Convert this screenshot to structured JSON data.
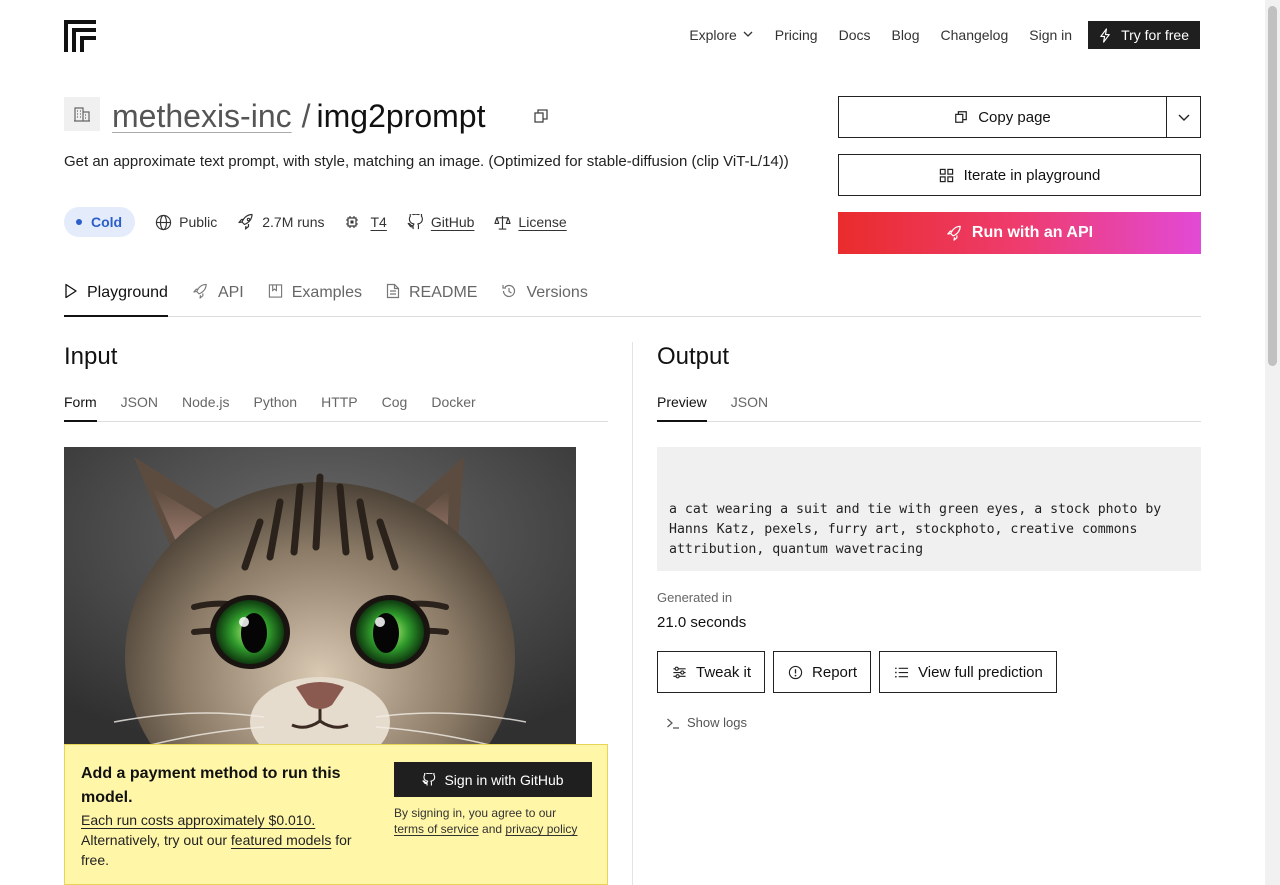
{
  "nav": {
    "explore": "Explore",
    "pricing": "Pricing",
    "docs": "Docs",
    "blog": "Blog",
    "changelog": "Changelog",
    "sign_in": "Sign in",
    "try_free": "Try for free"
  },
  "model": {
    "owner": "methexis-inc",
    "separator": "/",
    "name": "img2prompt",
    "description": "Get an approximate text prompt, with style, matching an image. (Optimized for stable-diffusion (clip ViT-L/14))",
    "status": "Cold",
    "visibility": "Public",
    "runs": "2.7M runs",
    "hardware": "T4",
    "github": "GitHub",
    "license": "License"
  },
  "actions": {
    "copy_page": "Copy page",
    "iterate": "Iterate in playground",
    "run_api": "Run with an API"
  },
  "tabs": [
    {
      "label": "Playground"
    },
    {
      "label": "API"
    },
    {
      "label": "Examples"
    },
    {
      "label": "README"
    },
    {
      "label": "Versions"
    }
  ],
  "input": {
    "title": "Input",
    "tabs": [
      "Form",
      "JSON",
      "Node.js",
      "Python",
      "HTTP",
      "Cog",
      "Docker"
    ]
  },
  "payment": {
    "title": "Add a payment method to run this model.",
    "cost": "Each run costs approximately $0.010.",
    "alt_prefix": "Alternatively, try out our",
    "featured": "featured models",
    "alt_suffix": "for free.",
    "github_btn": "Sign in with GitHub",
    "legal_prefix": "By signing in, you agree to our",
    "terms": "terms of service",
    "and": "and",
    "privacy": "privacy policy"
  },
  "output": {
    "title": "Output",
    "tabs": [
      "Preview",
      "JSON"
    ],
    "text": "a cat wearing a suit and tie with green eyes, a stock photo by Hanns Katz, pexels, furry art, stockphoto, creative commons attribution, quantum wavetracing",
    "generated_label": "Generated in",
    "generated_value": "21.0 seconds",
    "tweak": "Tweak it",
    "report": "Report",
    "view_full": "View full prediction",
    "show_logs": "Show logs"
  },
  "colors": {
    "accent_red": "#ea2c2c",
    "accent_pink": "#e24ad6",
    "cold_blue": "#2c5fc9",
    "warning_bg": "#fff6a8"
  }
}
